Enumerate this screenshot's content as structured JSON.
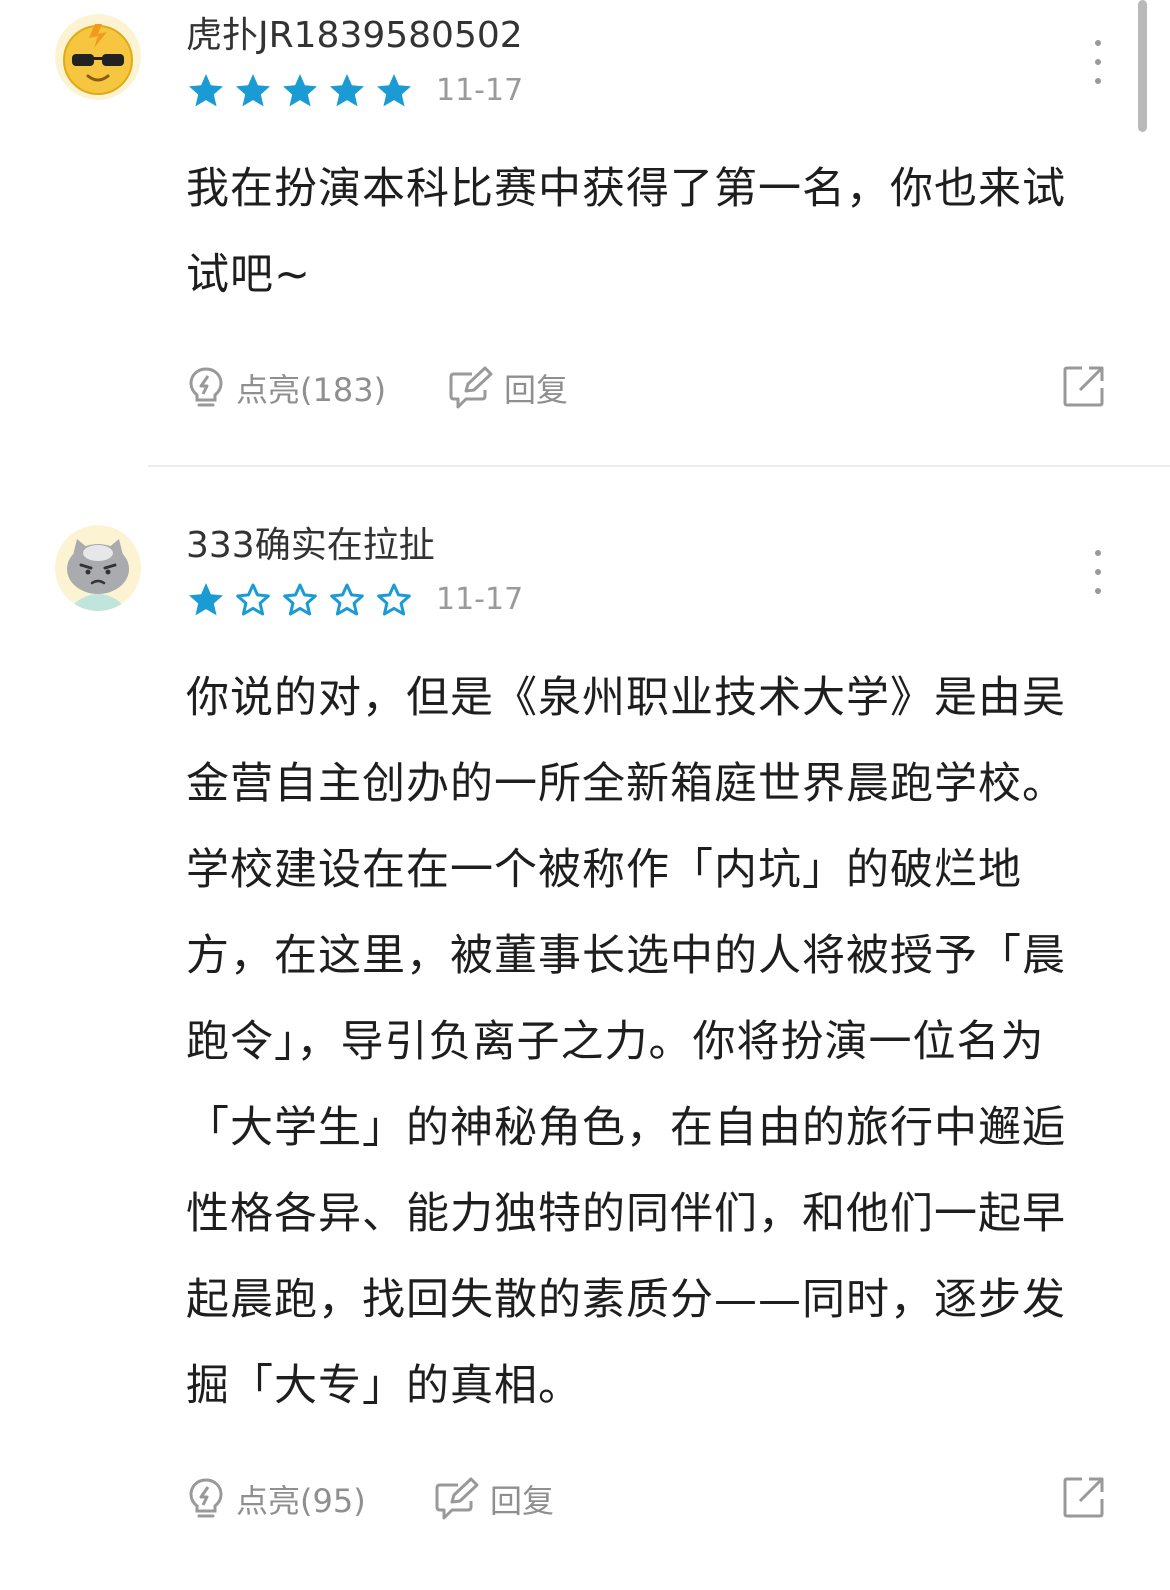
{
  "colors": {
    "star": "#1a9bd3",
    "muted": "#9a9a9a",
    "text": "#1e1e1e"
  },
  "comments": [
    {
      "username": "虎扑JR1839580502",
      "avatar_icon": "sunglasses-emoji-avatar",
      "rating": 5,
      "rating_max": 5,
      "date": "11-17",
      "body": "我在扮演本科比赛中获得了第一名，你也来试试吧~",
      "light_label": "点亮(183)",
      "reply_label": "回复"
    },
    {
      "username": "333确实在拉扯",
      "avatar_icon": "grumpy-grey-cat-avatar",
      "rating": 1,
      "rating_max": 5,
      "date": "11-17",
      "body": "你说的对，但是《泉州职业技术大学》是由吴金营自主创办的一所全新箱庭世界晨跑学校。学校建设在在一个被称作「内坑」的破烂地方，在这里，被董事长选中的人将被授予「晨跑令」，导引负离子之力。你将扮演一位名为「大学生」的神秘角色，在自由的旅行中邂逅性格各异、能力独特的同伴们，和他们一起早起晨跑，找回失散的素质分——同时，逐步发掘「大专」的真相。",
      "light_label": "点亮(95)",
      "reply_label": "回复"
    }
  ]
}
